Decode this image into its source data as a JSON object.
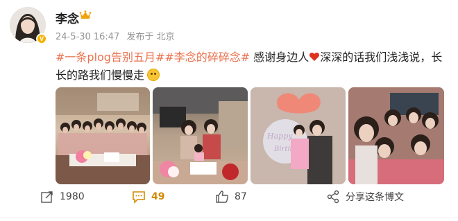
{
  "post": {
    "author": "李念",
    "author_badge_icon": "crown-icon",
    "verified_mark": "V",
    "date": "24-5-30 16:47",
    "posted_from": "发布于 北京",
    "text_parts": {
      "tag1": "#一条plog告别五月#",
      "tag2": "#李念的碎碎念#",
      "text1": " 感谢身边人",
      "text2": "深深的话我们浅浅说，长长的路我们慢慢走"
    },
    "images": [
      {
        "name": "group-photo-dining-table"
      },
      {
        "name": "photo-with-child-at-table"
      },
      {
        "name": "photo-happy-birthday-balloon"
      },
      {
        "name": "group-selfie-friends"
      }
    ]
  },
  "actions": {
    "share_count": "1980",
    "comment_count": "49",
    "like_count": "87",
    "share_to_weibo": "分享这条博文"
  },
  "colors": {
    "hashtag": "#eb7350",
    "comment_count": "#d48a00",
    "meta_gray": "#939393"
  }
}
